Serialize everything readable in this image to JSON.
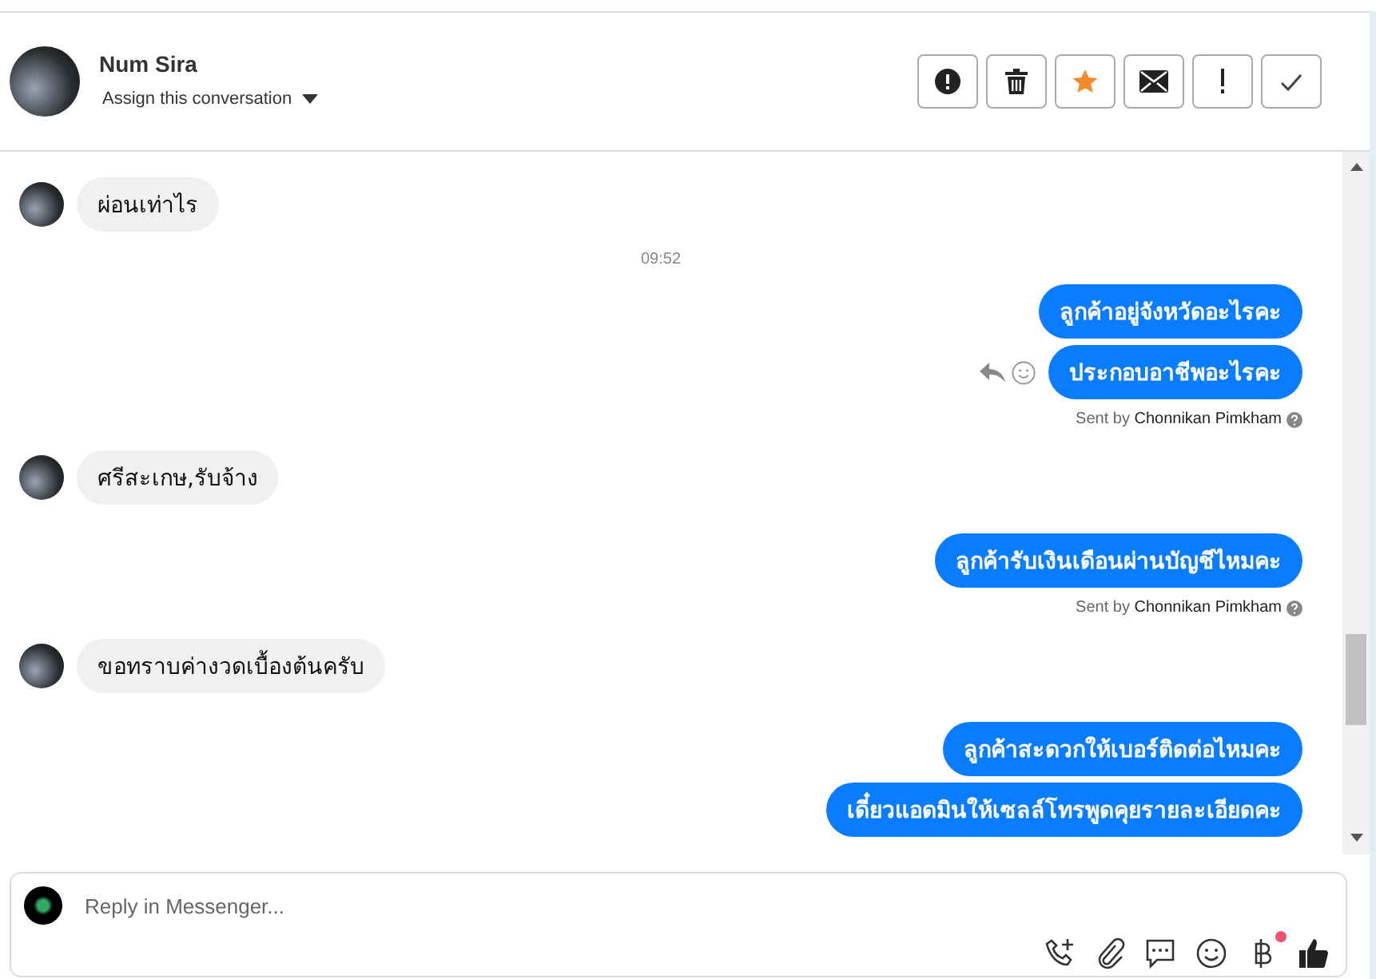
{
  "contact": {
    "name": "Num Sira",
    "assign": "Assign this conversation"
  },
  "actions": [
    {
      "kind": "alert"
    },
    {
      "kind": "trash"
    },
    {
      "kind": "star"
    },
    {
      "kind": "mail"
    },
    {
      "kind": "exclaim"
    },
    {
      "kind": "check"
    }
  ],
  "messages": [
    {
      "kind": "incoming",
      "text": "ผ่อนเท่าไร"
    },
    {
      "kind": "time",
      "text": "09:52"
    },
    {
      "kind": "outgoing",
      "text": "ลูกค้าอยู่จังหวัดอะไรคะ",
      "actions_shown": false
    },
    {
      "kind": "outgoing",
      "text": "ประกอบอาชีพอะไรคะ",
      "actions_shown": true
    },
    {
      "kind": "sent_by",
      "text": "Sent by **Chonnikan Pimkham**"
    },
    {
      "kind": "incoming",
      "text": "ศรีสะเกษ,รับจ้าง"
    },
    {
      "kind": "outgoing",
      "text": "ลูกค้ารับเงินเดือนผ่านบัญชีไหมคะ",
      "actions_shown": false
    },
    {
      "kind": "sent_by",
      "text": "Sent by **Chonnikan Pimkham**"
    },
    {
      "kind": "incoming",
      "text": "ขอทราบค่างวดเบื้องต้นครับ"
    },
    {
      "kind": "outgoing",
      "text": "ลูกค้าสะดวกให้เบอร์ติดต่อไหมคะ",
      "actions_shown": false
    },
    {
      "kind": "outgoing",
      "text": "เดี๋ยวแอดมินให้เซลล์โทรพูดคุยรายละเอียดคะ",
      "actions_shown": false
    }
  ],
  "composer": {
    "placeholder": "Reply in Messenger..."
  },
  "tools": [
    {
      "kind": "call",
      "badge": false
    },
    {
      "kind": "attach",
      "badge": false
    },
    {
      "kind": "chat",
      "badge": false
    },
    {
      "kind": "emoji",
      "badge": false
    },
    {
      "kind": "baht",
      "badge": true
    },
    {
      "kind": "like",
      "badge": false
    }
  ]
}
